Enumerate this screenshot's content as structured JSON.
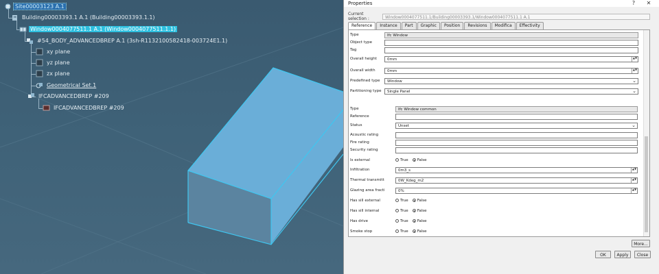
{
  "tree": {
    "nodes": [
      {
        "label": "Site00003123 A.1"
      },
      {
        "label": "Building00003393.1 A.1 (Building00003393.1.1)"
      },
      {
        "label": "Window0004077511.1 A.1 (Window0004077511.1.1)"
      },
      {
        "label": "#54_BODY_ADVANCEDBREP A.1 (3sh-R1132100582418-003724E1.1)"
      },
      {
        "label": "xy plane"
      },
      {
        "label": "yz plane"
      },
      {
        "label": "zx plane"
      },
      {
        "label": "Geometrical Set.1"
      },
      {
        "label": "IFCADVANCEDBREP #209"
      },
      {
        "label": "IFCADVANCEDBREP #209"
      }
    ]
  },
  "dialog": {
    "title": "Properties",
    "help_label": "?",
    "close_label": "✕",
    "current_selection_label": "Current selection :",
    "current_selection_value": "Window0004077511.1/Building00003393.1/Window0004077511.1 A.1",
    "tabs": [
      "Reference",
      "Instance",
      "Part",
      "Graphic",
      "Position",
      "Revisions",
      "Modifica",
      "Effectivity"
    ],
    "active_tab": "Reference",
    "rows": [
      {
        "label": "Type",
        "value": "Ifc Window",
        "kind": "header"
      },
      {
        "label": "Object type",
        "value": "",
        "kind": "text"
      },
      {
        "label": "Tag",
        "value": "",
        "kind": "text"
      },
      {
        "label": "Overall height",
        "value": "0mm",
        "kind": "spin"
      },
      {
        "label": "Overall width",
        "value": "0mm",
        "kind": "spin"
      },
      {
        "label": "Predefined type",
        "value": "Window",
        "kind": "dropdown"
      },
      {
        "label": "Partitioning type",
        "value": "Single Panel",
        "kind": "dropdown"
      },
      {
        "label": "Type",
        "value": "Ifc Window common",
        "kind": "header"
      },
      {
        "label": "Reference",
        "value": "",
        "kind": "text"
      },
      {
        "label": "Status",
        "value": "Unset",
        "kind": "dropdown"
      },
      {
        "label": "Acoustic rating",
        "value": "",
        "kind": "text"
      },
      {
        "label": "Fire rating",
        "value": "",
        "kind": "text"
      },
      {
        "label": "Security rating",
        "value": "",
        "kind": "text"
      },
      {
        "label": "Is external",
        "kind": "radio",
        "selected": "False"
      },
      {
        "label": "Infiltration",
        "value": "0m3_s",
        "kind": "spin"
      },
      {
        "label": "Thermal transmittance",
        "value": "0W_Kdeg_m2",
        "kind": "spin"
      },
      {
        "label": "Glazing area fraction",
        "value": "0%",
        "kind": "spin"
      },
      {
        "label": "Has sill external",
        "kind": "radio",
        "selected": "False"
      },
      {
        "label": "Has sill internal",
        "kind": "radio",
        "selected": "False"
      },
      {
        "label": "Has drive",
        "kind": "radio",
        "selected": "False"
      },
      {
        "label": "Smoke stop",
        "kind": "radio",
        "selected": "False"
      }
    ],
    "radio_true": "True",
    "radio_false": "False",
    "more_button": "More...",
    "ok_button": "OK",
    "apply_button": "Apply",
    "close_button": "Close"
  },
  "colors": {
    "viewport_bg": "#3f6278",
    "box_top": "#6aaed8",
    "box_front": "#5e8aa8",
    "box_edge": "#3fc6f0",
    "selection": "#2ec0e0"
  }
}
